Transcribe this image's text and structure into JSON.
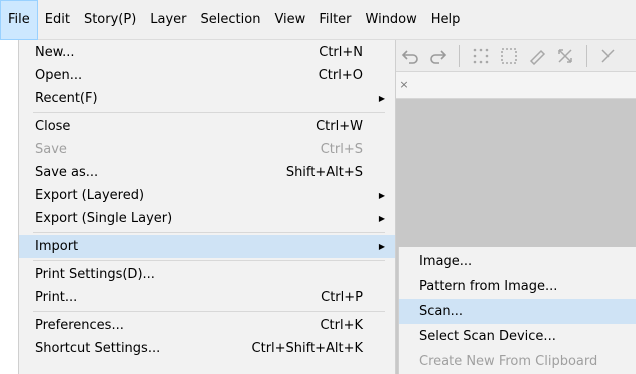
{
  "menubar": {
    "items": [
      "File",
      "Edit",
      "Story(P)",
      "Layer",
      "Selection",
      "View",
      "Filter",
      "Window",
      "Help"
    ]
  },
  "file_menu": {
    "items": [
      {
        "label": "New...",
        "shortcut": "Ctrl+N"
      },
      {
        "label": "Open...",
        "shortcut": "Ctrl+O"
      },
      {
        "label": "Recent(F)",
        "shortcut": ""
      },
      {
        "label": "Close",
        "shortcut": "Ctrl+W"
      },
      {
        "label": "Save",
        "shortcut": "Ctrl+S"
      },
      {
        "label": "Save as...",
        "shortcut": "Shift+Alt+S"
      },
      {
        "label": "Export (Layered)",
        "shortcut": ""
      },
      {
        "label": "Export (Single Layer)",
        "shortcut": ""
      },
      {
        "label": "Import",
        "shortcut": ""
      },
      {
        "label": "Print Settings(D)...",
        "shortcut": ""
      },
      {
        "label": "Print...",
        "shortcut": "Ctrl+P"
      },
      {
        "label": "Preferences...",
        "shortcut": "Ctrl+K"
      },
      {
        "label": "Shortcut Settings...",
        "shortcut": "Ctrl+Shift+Alt+K"
      }
    ]
  },
  "import_submenu": {
    "items": [
      {
        "label": "Image..."
      },
      {
        "label": "Pattern from Image..."
      },
      {
        "label": "Scan..."
      },
      {
        "label": "Select Scan Device..."
      },
      {
        "label": "Create New From Clipboard"
      }
    ]
  },
  "canvas_tab": {
    "close_glyph": "×"
  },
  "colors": {
    "menu_bg": "#f2f2f2",
    "highlight": "#cfe3f5",
    "active_menubar": "#cde8ff",
    "disabled_text": "#a0a0a0",
    "canvas": "#c8c8c8"
  },
  "icons": [
    "undo-icon",
    "redo-icon",
    "select-all-icon",
    "deselect-icon",
    "lasso-icon",
    "transform-icon",
    "clear-icon"
  ]
}
